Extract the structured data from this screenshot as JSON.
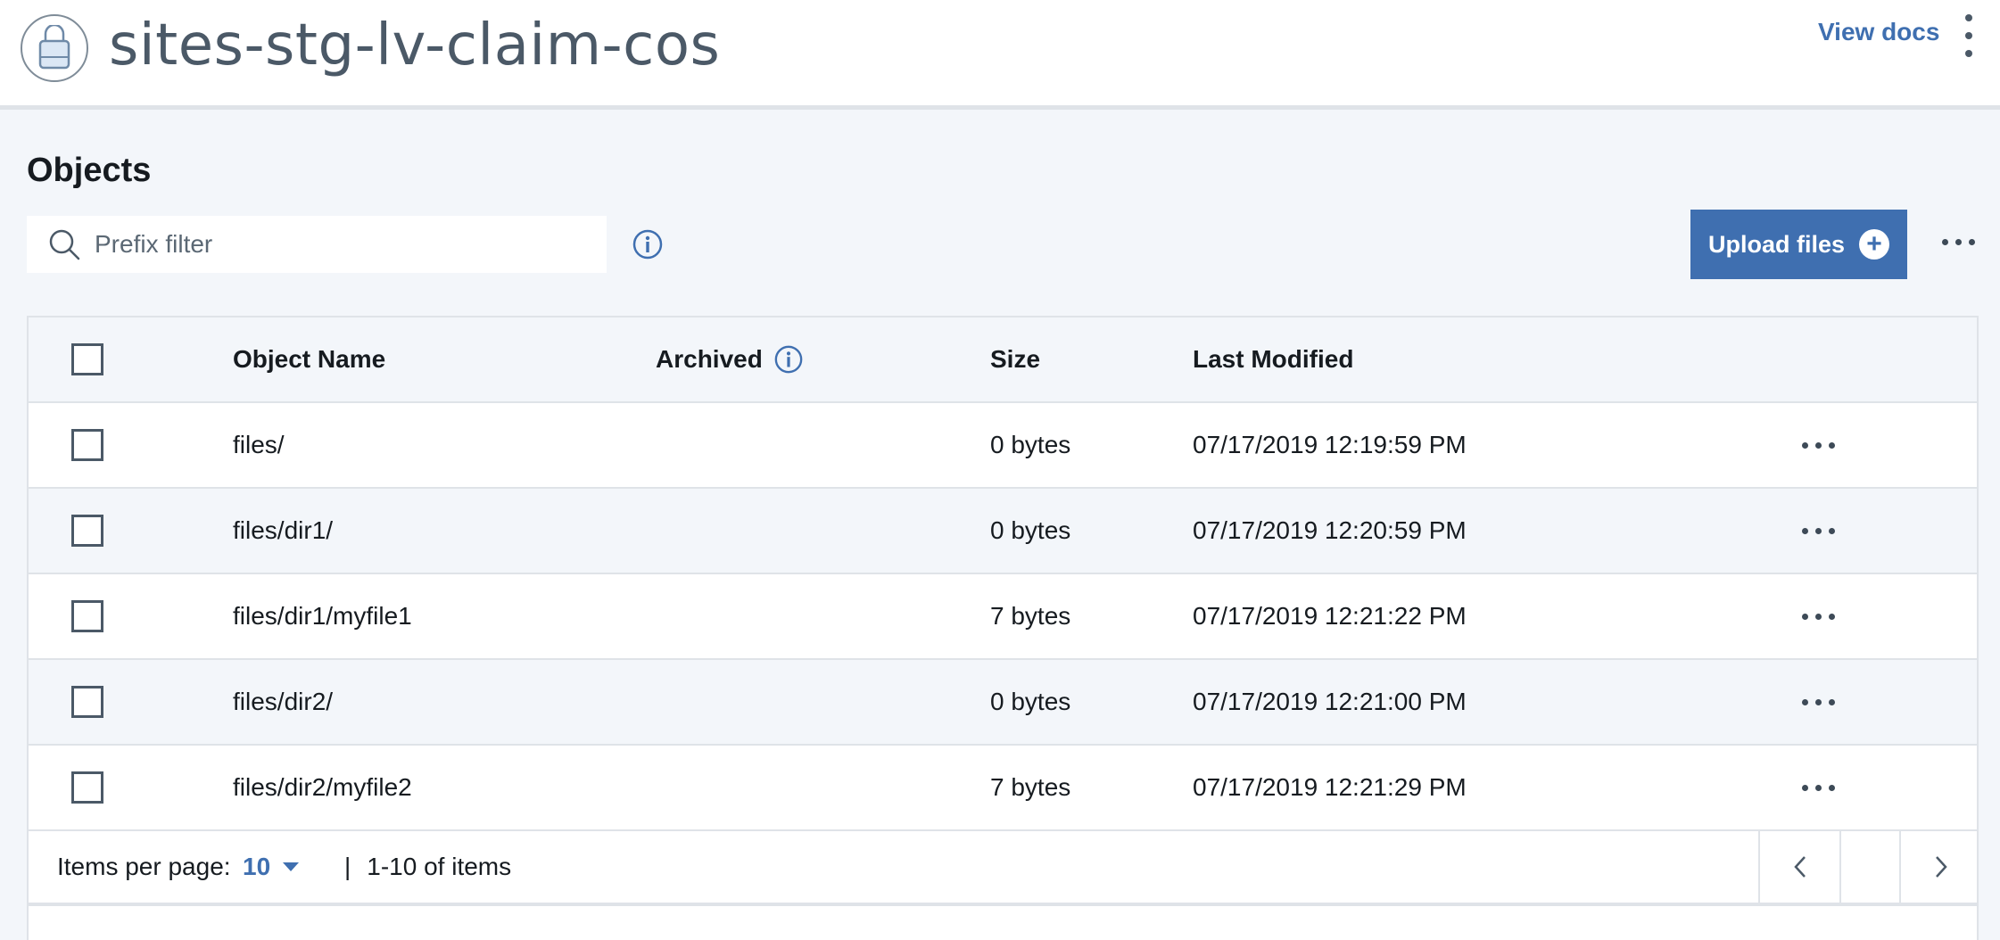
{
  "header": {
    "title": "sites-stg-lv-claim-cos",
    "icon": "bucket-icon",
    "view_docs": "View docs"
  },
  "section": {
    "title": "Objects"
  },
  "search": {
    "placeholder": "Prefix filter",
    "value": ""
  },
  "toolbar": {
    "upload_label": "Upload files"
  },
  "table": {
    "columns": {
      "name": "Object Name",
      "archived": "Archived",
      "size": "Size",
      "modified": "Last Modified"
    },
    "rows": [
      {
        "name": "files/",
        "archived": "",
        "size": "0 bytes",
        "modified": "07/17/2019 12:19:59 PM"
      },
      {
        "name": "files/dir1/",
        "archived": "",
        "size": "0 bytes",
        "modified": "07/17/2019 12:20:59 PM"
      },
      {
        "name": "files/dir1/myfile1",
        "archived": "",
        "size": "7 bytes",
        "modified": "07/17/2019 12:21:22 PM"
      },
      {
        "name": "files/dir2/",
        "archived": "",
        "size": "0 bytes",
        "modified": "07/17/2019 12:21:00 PM"
      },
      {
        "name": "files/dir2/myfile2",
        "archived": "",
        "size": "7 bytes",
        "modified": "07/17/2019 12:21:29 PM"
      }
    ]
  },
  "pagination": {
    "items_per_page_label": "Items per page:",
    "items_per_page_value": "10",
    "separator": "|",
    "range": "1-10 of items"
  },
  "colors": {
    "accent": "#3f6fb0",
    "background": "#f3f6fa",
    "border": "#dfe3e8"
  }
}
